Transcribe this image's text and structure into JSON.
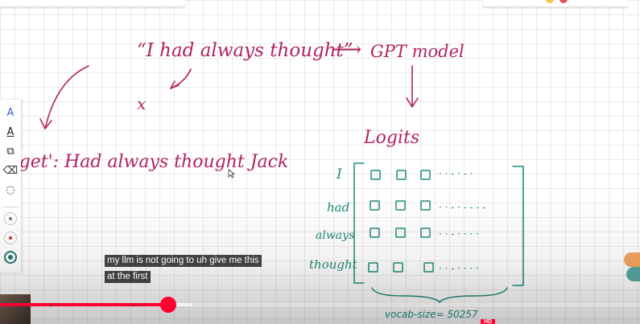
{
  "whiteboard": {
    "prompt_text": "“I had always thought”",
    "arrow_right": "⟶",
    "model_label": "GPT model",
    "x_label": "x",
    "target_text": "arget': Had always thought Jack",
    "logits_label": "Logits",
    "row_labels": [
      "I",
      "had",
      "always",
      "thought"
    ],
    "row_dots": [
      "· · - · - ·",
      "· · - · - - - -",
      "· · - · · · ·",
      "· · - · · · ·"
    ],
    "vocab_label": "vocab-size= 50257"
  },
  "toolbar": {
    "tools": [
      {
        "name": "pen-icon",
        "glyph": "A",
        "selected": true
      },
      {
        "name": "highlighter-icon",
        "glyph": "A",
        "selected": false
      },
      {
        "name": "shapes-icon",
        "glyph": "⧉",
        "selected": false
      },
      {
        "name": "eraser-icon",
        "glyph": "⌫",
        "selected": false
      },
      {
        "name": "lasso-icon",
        "glyph": "◌",
        "selected": false
      }
    ],
    "colors": [
      {
        "name": "color-white",
        "hex": "#ffffff",
        "dot": "#777777"
      },
      {
        "name": "color-red",
        "hex": "#c0392b",
        "dot": "#c0392b"
      },
      {
        "name": "color-teal",
        "hex": "#1f7a73",
        "dot": "#1f7a73"
      }
    ]
  },
  "captions": {
    "line1": "my llm is not going to uh give me this",
    "line2": "at the first"
  },
  "player": {
    "played_fraction": 0.265,
    "loaded_fraction": 0.3,
    "hd_badge": "HD",
    "accent": "#ff0033"
  },
  "colors": {
    "ink_magenta": "#b0245f",
    "ink_teal": "#1f8a7a"
  }
}
